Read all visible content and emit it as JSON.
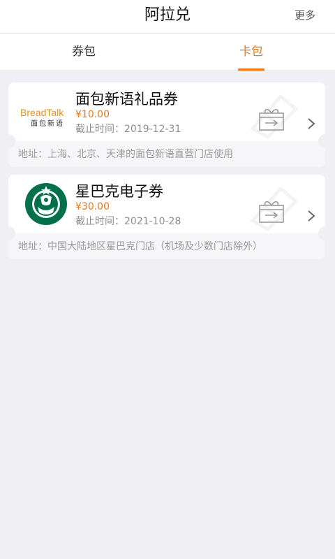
{
  "header": {
    "title": "阿拉兑",
    "more_label": "更多"
  },
  "tabs": [
    {
      "label": "券包",
      "active": false
    },
    {
      "label": "卡包",
      "active": true
    }
  ],
  "colors": {
    "accent": "#e8791f",
    "background": "#efeff4",
    "breadtalk_orange": "#e2901f",
    "starbucks_green": "#00704a"
  },
  "cards": [
    {
      "logo_text": "BreadTalk",
      "logo_subtext": "面包新语",
      "name": "面包新语礼品券",
      "price": "¥10.00",
      "expiry_label": "截止时间：",
      "expiry_date": "2019-12-31",
      "address": "地址：上海、北京、天津的面包新语直营门店使用",
      "icons": [
        "gift-icon",
        "chevron-right-icon"
      ]
    },
    {
      "logo_text": "",
      "name": "星巴克电子券",
      "price": "¥30.00",
      "expiry_label": "截止时间：",
      "expiry_date": "2021-10-28",
      "address": "地址：中国大陆地区星巴克门店（机场及少数门店除外）",
      "icons": [
        "gift-icon",
        "chevron-right-icon"
      ]
    }
  ]
}
